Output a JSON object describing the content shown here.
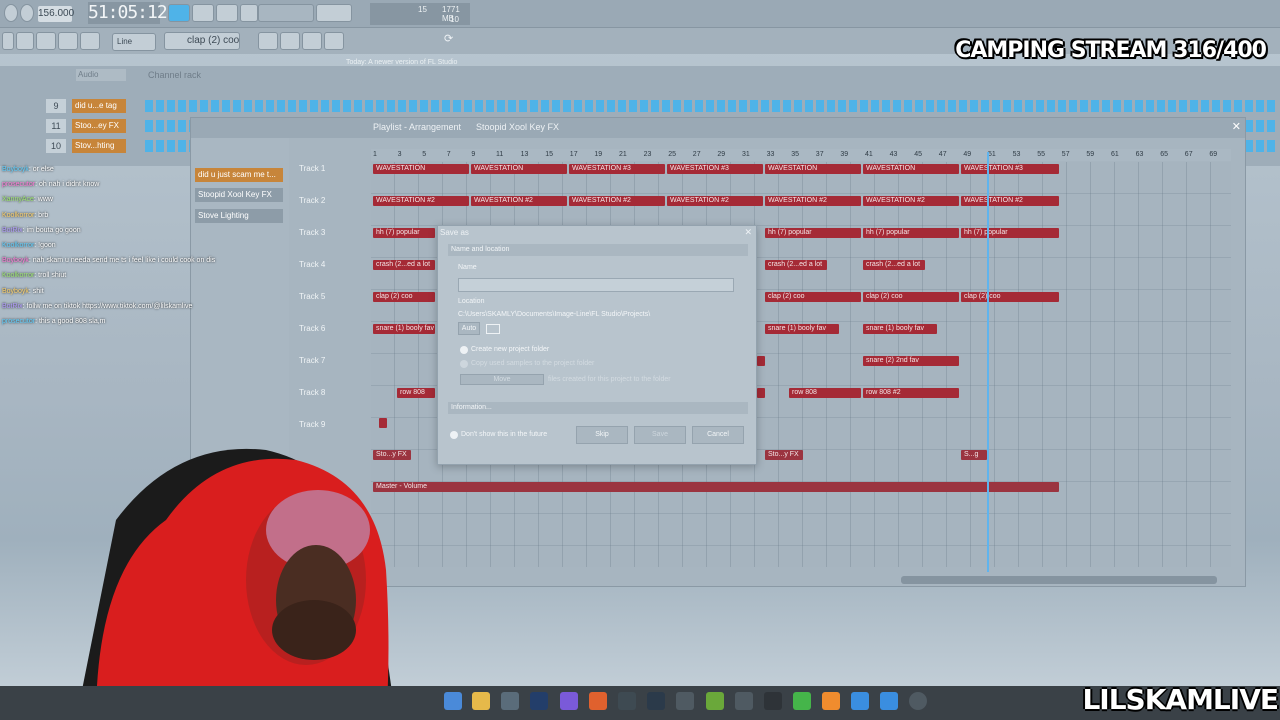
{
  "topbar": {
    "tempo": "156.000",
    "time": "51:05:12",
    "cpu_top": "15",
    "cpu_mem": "1771 MB",
    "cpu_poly": "10",
    "snap": "Line",
    "pattern": "clap (2) coo",
    "notice": "Today: A newer version of FL Studio is available!"
  },
  "overlay": {
    "stream_title": "CAMPING STREAM 316/400",
    "watermark": "LILSKAMLIVE"
  },
  "channel_rack": {
    "group": "Audio",
    "title": "Channel rack",
    "rows": [
      {
        "num": "9",
        "name": "did u...e tag"
      },
      {
        "num": "11",
        "name": "Stoo...ey FX"
      },
      {
        "num": "10",
        "name": "Stov...hting"
      }
    ]
  },
  "chat": [
    {
      "user": "Boyboyk",
      "msg": ": or else"
    },
    {
      "user": "prosecutor",
      "msg": ": oh nah i didnt know"
    },
    {
      "user": "XannyAce",
      "msg": ": www"
    },
    {
      "user": "Koolkorror",
      "msg": ": brb"
    },
    {
      "user": "BotRix",
      "msg": ": im bouta go goon"
    },
    {
      "user": "Koolkorror",
      "msg": ": !goon"
    },
    {
      "user": "Boyboyk",
      "msg": ": nah skam u needa send me ts i feel like i could cook on dis"
    },
    {
      "user": "Koolkorror",
      "msg": ": troll shiut"
    },
    {
      "user": "Boyboyk",
      "msg": ": shit"
    },
    {
      "user": "BotRix",
      "msg": ": follw me on tiktok https://www.tiktok.com/@lilskamlive"
    },
    {
      "user": "prosecutor",
      "msg": ": this a good 808 sla,m"
    }
  ],
  "playlist": {
    "title": "Playlist - Arrangement",
    "pattern": "Stoopid Xool Key FX",
    "picker": [
      "did u just scam me t...",
      "Stoopid Xool Key FX",
      "Stove Lighting"
    ],
    "ruler": [
      "1",
      "3",
      "5",
      "7",
      "9",
      "11",
      "13",
      "15",
      "17",
      "19",
      "21",
      "23",
      "25",
      "27",
      "29",
      "31",
      "33",
      "35",
      "37",
      "39",
      "41",
      "43",
      "45",
      "47",
      "49",
      "51",
      "53",
      "55",
      "57",
      "59",
      "61",
      "63",
      "65",
      "67",
      "69"
    ],
    "tracks": [
      "Track 1",
      "Track 2",
      "Track 3",
      "Track 4",
      "Track 5",
      "Track 6",
      "Track 7",
      "Track 8",
      "Track 9"
    ],
    "clips": {
      "t1": "WAVESTATION",
      "t1b": "WAVESTATION #3",
      "t2": "WAVESTATION #2",
      "t3": "hh (7) popular",
      "t4": "crash (2...ed a lot",
      "t5": "clap (2) coo",
      "t6": "snare (1) booly fav",
      "t7": "snare (2) 2nd fav",
      "t8": "row 808",
      "t8b": "row 808 #2",
      "fx": "Sto...y FX",
      "fx2": "S...g",
      "master": "Master - Volume"
    }
  },
  "dialog": {
    "title": "Save as",
    "section": "Name and location",
    "name_label": "Name",
    "name_value": "",
    "location_label": "Location",
    "location_value": "C:\\Users\\SKAMLY\\Documents\\Image-Line\\FL Studio\\Projects\\",
    "auto": "Auto",
    "opt1": "Create new project folder",
    "opt2": "Copy used samples to the project folder",
    "opt3": "files created for this project to the folder",
    "move": "Move",
    "info": "Information...",
    "dont_show": "Don't show this in the future",
    "skip": "Skip",
    "save": "Save",
    "cancel": "Cancel"
  },
  "colors": {
    "clip": "#a52a36",
    "accent": "#4fb3e8",
    "rack_name": "#c7853a"
  }
}
